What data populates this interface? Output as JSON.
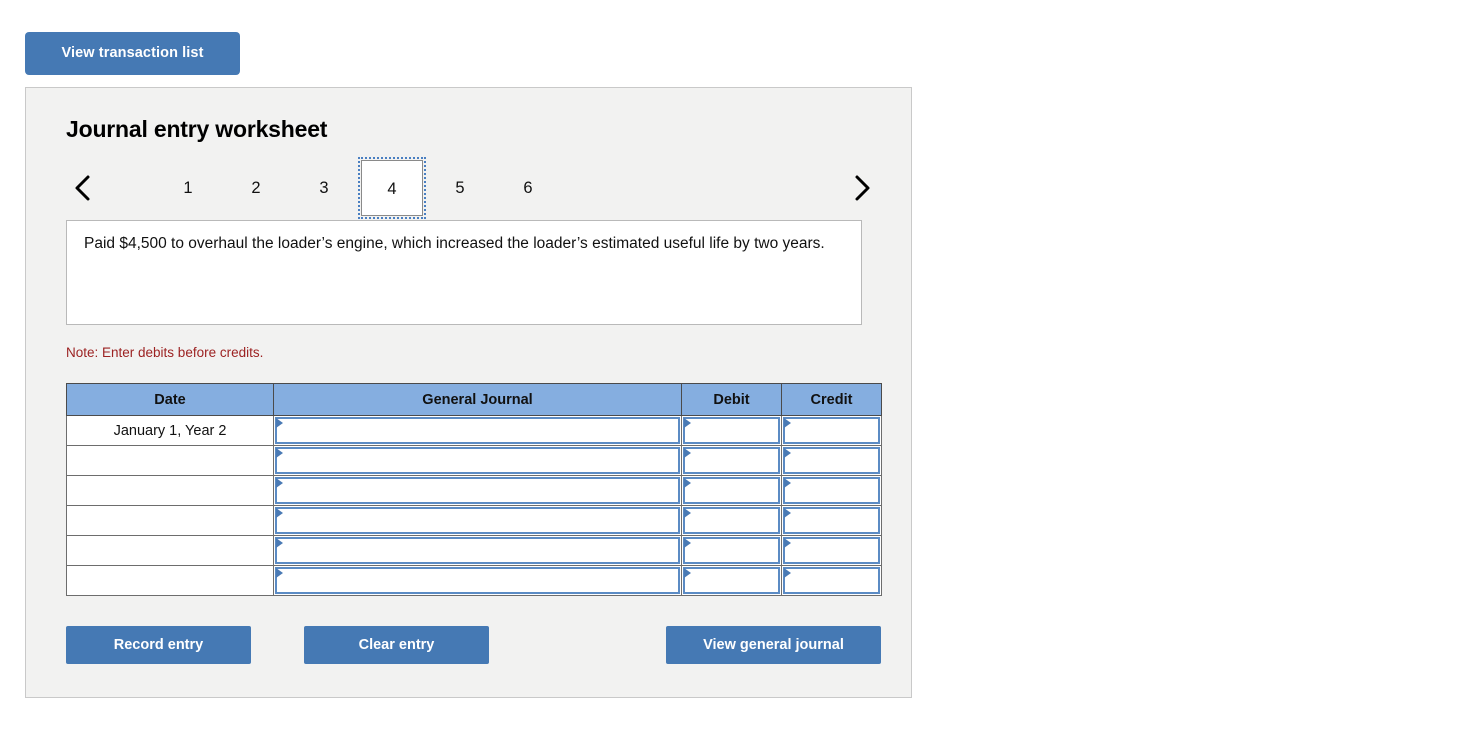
{
  "top_bar": {
    "view_transaction_list_label": "View transaction list"
  },
  "panel": {
    "title": "Journal entry worksheet"
  },
  "pager": {
    "prev_icon": "chevron-left-icon",
    "next_icon": "chevron-right-icon",
    "tabs": [
      {
        "label": "1",
        "active": false
      },
      {
        "label": "2",
        "active": false
      },
      {
        "label": "3",
        "active": false
      },
      {
        "label": "4",
        "active": true
      },
      {
        "label": "5",
        "active": false
      },
      {
        "label": "6",
        "active": false
      }
    ],
    "active_tab": "4"
  },
  "description": {
    "text": "Paid $4,500 to overhaul the loader’s engine, which increased the loader’s estimated useful life by two years."
  },
  "note": {
    "text": "Note: Enter debits before credits."
  },
  "journal_table": {
    "headers": {
      "date": "Date",
      "general_journal": "General Journal",
      "debit": "Debit",
      "credit": "Credit"
    },
    "rows": [
      {
        "date": "January 1, Year 2",
        "general_journal": "",
        "debit": "",
        "credit": ""
      },
      {
        "date": "",
        "general_journal": "",
        "debit": "",
        "credit": ""
      },
      {
        "date": "",
        "general_journal": "",
        "debit": "",
        "credit": ""
      },
      {
        "date": "",
        "general_journal": "",
        "debit": "",
        "credit": ""
      },
      {
        "date": "",
        "general_journal": "",
        "debit": "",
        "credit": ""
      },
      {
        "date": "",
        "general_journal": "",
        "debit": "",
        "credit": ""
      }
    ]
  },
  "actions": {
    "record_entry_label": "Record entry",
    "clear_entry_label": "Clear entry",
    "view_general_journal_label": "View general journal"
  },
  "colors": {
    "button_blue": "#4579b4",
    "table_header_blue": "#85aee0",
    "input_border_blue": "#5b8bc4",
    "note_red": "#9c2222",
    "panel_background": "#f2f2f1",
    "panel_border": "#c9c9c9"
  }
}
